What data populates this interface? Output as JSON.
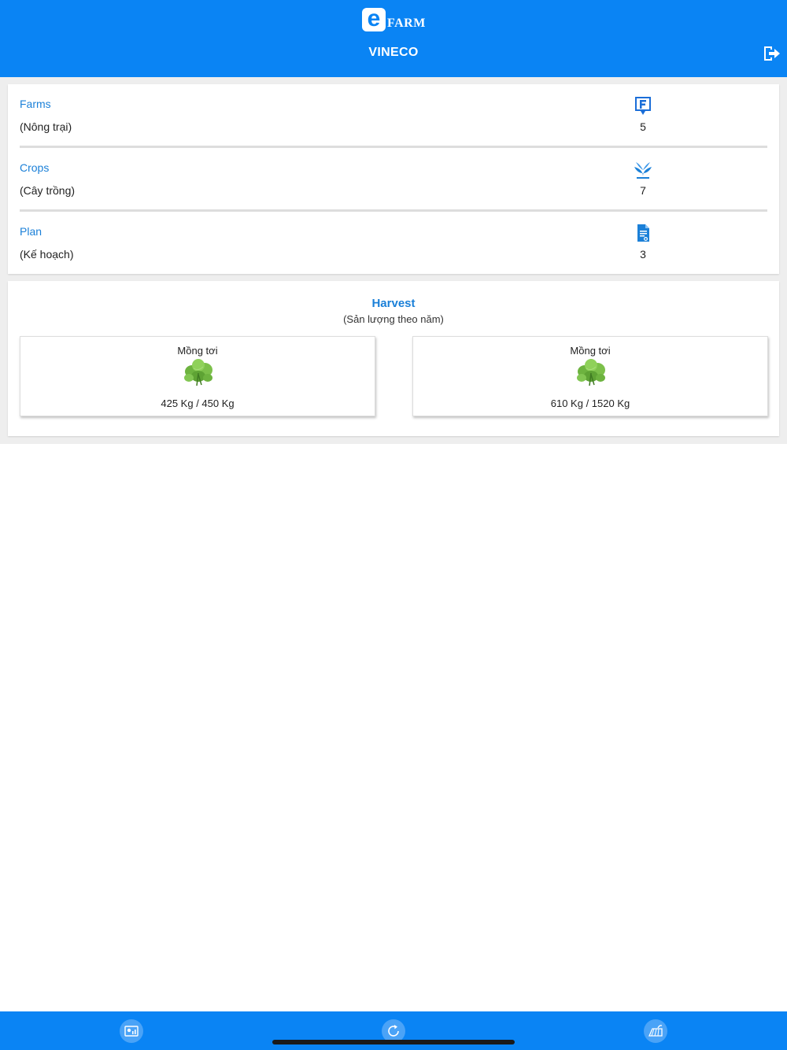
{
  "header": {
    "logo_letter": "e",
    "logo_text": "FARM",
    "org_name": "VINECO",
    "logout_icon": "logout-icon"
  },
  "summary": {
    "items": [
      {
        "title": "Farms",
        "subtitle": "(Nông trại)",
        "count": "5",
        "icon": "farm-marker-icon"
      },
      {
        "title": "Crops",
        "subtitle": "(Cây trồng)",
        "count": "7",
        "icon": "plant-icon"
      },
      {
        "title": "Plan",
        "subtitle": "(Kế hoạch)",
        "count": "3",
        "icon": "document-icon"
      }
    ]
  },
  "harvest": {
    "title": "Harvest",
    "subtitle": "(Sản lượng theo năm)",
    "crops": [
      {
        "name": "Mồng tơi",
        "amount": "425 Kg / 450 Kg",
        "image": "leafy-vegetable-image"
      },
      {
        "name": "Mồng tơi",
        "amount": "610 Kg / 1520 Kg",
        "image": "leafy-vegetable-image"
      }
    ]
  },
  "bottom_nav": {
    "items": [
      {
        "icon": "dashboard-icon"
      },
      {
        "icon": "refresh-icon"
      },
      {
        "icon": "field-icon"
      }
    ]
  },
  "colors": {
    "primary": "#0a84f4",
    "link": "#1b80d8",
    "background": "#eeeeee"
  }
}
